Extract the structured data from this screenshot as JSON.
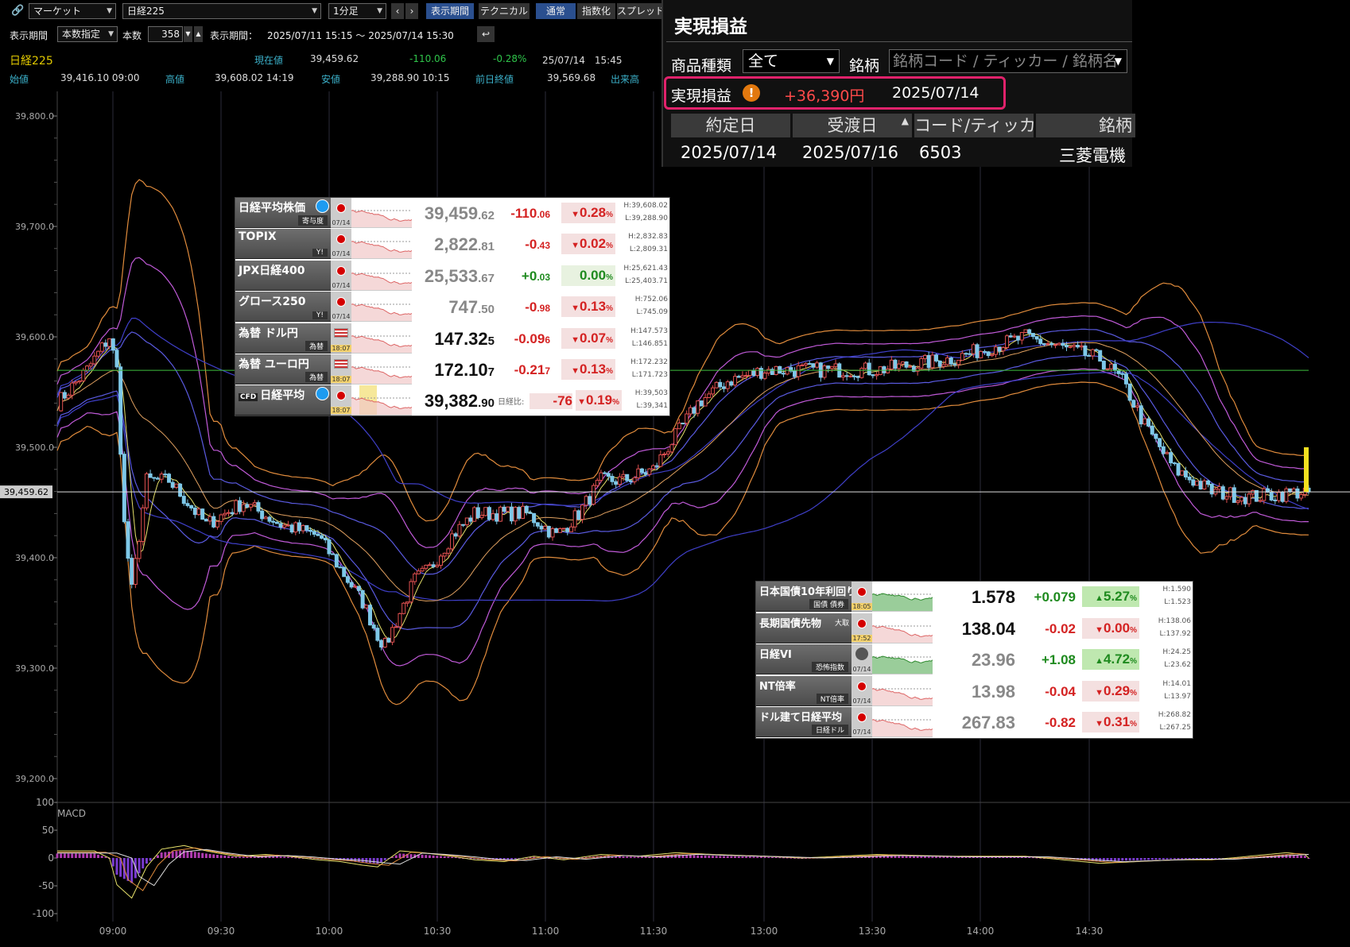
{
  "toolbar": {
    "market_select": "マーケット",
    "symbol_select": "日経225",
    "interval_select": "1分足",
    "btn_display_period": "表示期間",
    "btn_technical": "テクニカル",
    "btn_normal": "通常",
    "btn_index": "指数化",
    "btn_spread": "スプレッド",
    "period_label": "表示期間",
    "period_mode": "本数指定",
    "count_label": "本数",
    "count_value": "358",
    "range_label": "表示期間：",
    "range_value": "2025/07/11 15:15 ～ 2025/07/14 15:30"
  },
  "quote": {
    "name": "日経225",
    "current_label": "現在値",
    "current": "39,459.62",
    "change": "-110.06",
    "change_pct": "-0.28%",
    "datetime": "25/07/14　15:45",
    "open_label": "始値",
    "open": "39,416.10 09:00",
    "high_label": "高値",
    "high": "39,608.02 14:19",
    "low_label": "安値",
    "low": "39,288.90 10:15",
    "prev_label": "前日終値",
    "prev": "39,569.68",
    "volume_label": "出来高"
  },
  "chart_data": {
    "type": "candlestick",
    "ylim": [
      39200,
      39800
    ],
    "y_ticks": [
      "39,800.0",
      "39,700.0",
      "39,600.0",
      "39,500.0",
      "39,400.0",
      "39,300.0",
      "39,200.0"
    ],
    "x_ticks": [
      "09:00",
      "09:30",
      "10:00",
      "10:30",
      "11:00",
      "11:30",
      "13:00",
      "13:30",
      "14:00",
      "14:30"
    ],
    "last_price_label": "39,459.62",
    "last_price": 39459.62,
    "prev_close": 39569.68,
    "path": [
      [
        0,
        39540
      ],
      [
        8,
        39570
      ],
      [
        14,
        39600
      ],
      [
        16,
        39570
      ],
      [
        18,
        39430
      ],
      [
        20,
        39370
      ],
      [
        24,
        39470
      ],
      [
        30,
        39470
      ],
      [
        40,
        39430
      ],
      [
        50,
        39450
      ],
      [
        60,
        39430
      ],
      [
        70,
        39420
      ],
      [
        76,
        39390
      ],
      [
        82,
        39360
      ],
      [
        86,
        39330
      ],
      [
        88,
        39320
      ],
      [
        92,
        39350
      ],
      [
        96,
        39380
      ],
      [
        100,
        39390
      ],
      [
        106,
        39420
      ],
      [
        112,
        39440
      ],
      [
        118,
        39440
      ],
      [
        126,
        39440
      ],
      [
        134,
        39420
      ],
      [
        140,
        39440
      ],
      [
        146,
        39470
      ],
      [
        152,
        39470
      ],
      [
        160,
        39480
      ],
      [
        166,
        39510
      ],
      [
        172,
        39540
      ],
      [
        180,
        39560
      ],
      [
        190,
        39570
      ],
      [
        200,
        39570
      ],
      [
        210,
        39570
      ],
      [
        220,
        39570
      ],
      [
        230,
        39575
      ],
      [
        240,
        39580
      ],
      [
        250,
        39590
      ],
      [
        260,
        39600
      ],
      [
        270,
        39590
      ],
      [
        280,
        39580
      ],
      [
        286,
        39560
      ],
      [
        292,
        39520
      ],
      [
        300,
        39480
      ],
      [
        310,
        39460
      ],
      [
        320,
        39455
      ],
      [
        330,
        39458
      ],
      [
        335,
        39460
      ]
    ],
    "macd": {
      "label": "MACD",
      "ylim": [
        -100,
        100
      ],
      "y_ticks": [
        "100",
        "50",
        "0",
        "-50",
        "-100"
      ],
      "hist": [
        [
          0,
          8
        ],
        [
          10,
          8
        ],
        [
          14,
          0
        ],
        [
          16,
          -30
        ],
        [
          20,
          -45
        ],
        [
          24,
          -10
        ],
        [
          28,
          10
        ],
        [
          34,
          14
        ],
        [
          40,
          8
        ],
        [
          48,
          2
        ],
        [
          56,
          4
        ],
        [
          62,
          2
        ],
        [
          70,
          -2
        ],
        [
          76,
          -4
        ],
        [
          82,
          -8
        ],
        [
          86,
          -10
        ],
        [
          92,
          8
        ],
        [
          98,
          6
        ],
        [
          106,
          2
        ],
        [
          112,
          -2
        ],
        [
          120,
          -4
        ],
        [
          128,
          2
        ],
        [
          136,
          -2
        ],
        [
          146,
          4
        ],
        [
          156,
          2
        ],
        [
          166,
          6
        ],
        [
          176,
          4
        ],
        [
          190,
          2
        ],
        [
          200,
          0
        ],
        [
          210,
          2
        ],
        [
          220,
          4
        ],
        [
          240,
          2
        ],
        [
          260,
          2
        ],
        [
          270,
          -2
        ],
        [
          280,
          -6
        ],
        [
          290,
          -4
        ],
        [
          300,
          -2
        ],
        [
          310,
          -2
        ],
        [
          320,
          2
        ],
        [
          330,
          6
        ],
        [
          335,
          4
        ]
      ]
    }
  },
  "quotes_top": [
    {
      "name": "日経平均株価",
      "sub": "寄与度",
      "date": "07/14",
      "flag": "jp",
      "x": true,
      "price_main": "39,459",
      "price_dec": ".62",
      "price_color": "gray",
      "chg_main": "-110",
      "chg_dec": ".06",
      "dir": "dn",
      "pct_main": "0.28",
      "h": "H:39,608.02",
      "l": "L:39,288.90"
    },
    {
      "name": "TOPIX",
      "sub": "Y!",
      "date": "07/14",
      "flag": "jp",
      "price_main": "2,822",
      "price_dec": ".81",
      "price_color": "gray",
      "chg_main": "-0",
      "chg_dec": ".43",
      "dir": "dn",
      "pct_main": "0.02",
      "h": "H:2,832.83",
      "l": "L:2,809.31"
    },
    {
      "name": "JPX日経400",
      "sub": "",
      "date": "07/14",
      "flag": "jp",
      "price_main": "25,533",
      "price_dec": ".67",
      "price_color": "gray",
      "chg_main": "+0",
      "chg_dec": ".03",
      "dir": "fl",
      "pct_main": "0.00",
      "h": "H:25,621.43",
      "l": "L:25,403.71"
    },
    {
      "name": "グロース250",
      "sub": "Y!",
      "date": "07/14",
      "flag": "jp",
      "price_main": "747",
      "price_dec": ".50",
      "price_color": "gray",
      "chg_main": "-0",
      "chg_dec": ".98",
      "dir": "dn",
      "pct_main": "0.13",
      "h": "H:752.06",
      "l": "L:745.09"
    },
    {
      "name": "為替 ドル円",
      "sub": "為替",
      "date": "18:07",
      "flag": "us",
      "price_main": "147.32",
      "price_dec": "5",
      "price_color": "black",
      "chg_main": "-0.09",
      "chg_dec": "6",
      "dir": "dn",
      "pct_main": "0.07",
      "h": "H:147.573",
      "l": "L:146.851"
    },
    {
      "name": "為替 ユーロ円",
      "sub": "為替",
      "date": "18:07",
      "flag": "eu",
      "price_main": "172.10",
      "price_dec": "7",
      "price_color": "black",
      "chg_main": "-0.21",
      "chg_dec": "7",
      "dir": "dn",
      "pct_main": "0.13",
      "h": "H:172.232",
      "l": "L:171.723"
    },
    {
      "name": "日経平均",
      "cfd": "CFD",
      "x": true,
      "sub": "",
      "date": "18:07",
      "flag": "jp",
      "price_main": "39,382",
      "price_dec": ".90",
      "price_color": "black",
      "ratio_label": "日経比:",
      "chg_main": "-76",
      "chg_dec": "",
      "dir": "dn",
      "pct_main": "0.19",
      "h": "H:39,503",
      "l": "L:39,341"
    }
  ],
  "quotes_bottom": [
    {
      "name": "日本国債10年利回り",
      "sub": "国債 債券",
      "date": "18:05",
      "flag": "jp",
      "price": "1.578",
      "price_color": "black",
      "chg": "+0.079",
      "dir": "up",
      "pct": "5.27",
      "h": "H:1.590",
      "l": "L:1.523"
    },
    {
      "name": "長期国債先物",
      "tag": "大取",
      "sub": "",
      "date": "17:52",
      "flag": "jp",
      "price": "138.04",
      "price_color": "black",
      "chg": "-0.02",
      "dir": "dn",
      "pct": "0.00",
      "h": "H:138.06",
      "l": "L:137.92"
    },
    {
      "name": "日経VI",
      "sub": "恐怖指数",
      "date": "07/14",
      "flag": "vi",
      "price": "23.96",
      "price_color": "gray",
      "chg": "+1.08",
      "dir": "up",
      "pct": "4.72",
      "h": "H:24.25",
      "l": "L:23.62"
    },
    {
      "name": "NT倍率",
      "sub": "NT倍率",
      "date": "07/14",
      "flag": "jp",
      "price": "13.98",
      "price_color": "gray",
      "chg": "-0.04",
      "dir": "dn",
      "pct": "0.29",
      "h": "H:14.01",
      "l": "L:13.97"
    },
    {
      "name": "ドル建て日経平均",
      "sub": "日経ドル",
      "date": "07/14",
      "flag": "jp",
      "price": "267.83",
      "price_color": "gray",
      "chg": "-0.82",
      "dir": "dn",
      "pct": "0.31",
      "h": "H:268.82",
      "l": "L:267.25"
    }
  ],
  "realized": {
    "title": "実現損益",
    "product_type_label": "商品種類",
    "product_type_value": "全て",
    "issue_label": "銘柄",
    "issue_placeholder": "銘柄コード / ティッカー / 銘柄名",
    "pnl_label": "実現損益",
    "pnl_value": "+36,390円",
    "pnl_date": "2025/07/14",
    "columns": [
      "約定日",
      "受渡日",
      "コード/ティッカー",
      "銘柄"
    ],
    "row": [
      "2025/07/14",
      "2025/07/16",
      "6503",
      "三菱電機"
    ],
    "highlight_color": "#e0226b"
  }
}
